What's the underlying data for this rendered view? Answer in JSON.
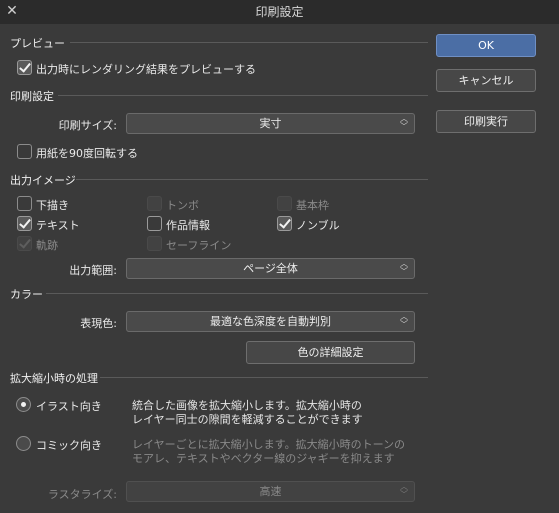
{
  "window": {
    "title": "印刷設定",
    "close_glyph": "✕"
  },
  "preview": {
    "heading": "プレビュー",
    "render_preview_label": "出力時にレンダリング結果をプレビューする",
    "render_preview_checked": true
  },
  "print_settings": {
    "heading": "印刷設定",
    "size_label": "印刷サイズ:",
    "size_value": "実寸",
    "rotate_label": "用紙を90度回転する",
    "rotate_checked": false
  },
  "output_image": {
    "heading": "出力イメージ",
    "options": [
      {
        "label": "下描き",
        "checked": false,
        "enabled": true
      },
      {
        "label": "トンボ",
        "checked": false,
        "enabled": false
      },
      {
        "label": "基本枠",
        "checked": false,
        "enabled": false
      },
      {
        "label": "テキスト",
        "checked": true,
        "enabled": true
      },
      {
        "label": "作品情報",
        "checked": false,
        "enabled": true
      },
      {
        "label": "ノンブル",
        "checked": true,
        "enabled": true
      },
      {
        "label": "軌跡",
        "checked": true,
        "enabled": false
      },
      {
        "label": "セーフライン",
        "checked": false,
        "enabled": false
      }
    ],
    "range_label": "出力範囲:",
    "range_value": "ページ全体"
  },
  "color": {
    "heading": "カラー",
    "expression_label": "表現色:",
    "expression_value": "最適な色深度を自動判別",
    "detail_button": "色の詳細設定"
  },
  "scaling": {
    "heading": "拡大縮小時の処理",
    "illustration_label": "イラスト向き",
    "illustration_desc_1": "統合した画像を拡大縮小します。拡大縮小時の",
    "illustration_desc_2": "レイヤー同士の隙間を軽減することができます",
    "comic_label": "コミック向き",
    "comic_desc_1": "レイヤーごとに拡大縮小します。拡大縮小時のトーンの",
    "comic_desc_2": "モアレ、テキストやベクター線のジャギーを抑えます",
    "selected": "illustration",
    "rasterize_label": "ラスタライズ:",
    "rasterize_value": "高速"
  },
  "buttons": {
    "ok": "OK",
    "cancel": "キャンセル",
    "print": "印刷実行"
  },
  "colors": {
    "accent": "#4b6ea5",
    "background": "#3a3a3a",
    "titlebar": "#2b2b2b"
  }
}
